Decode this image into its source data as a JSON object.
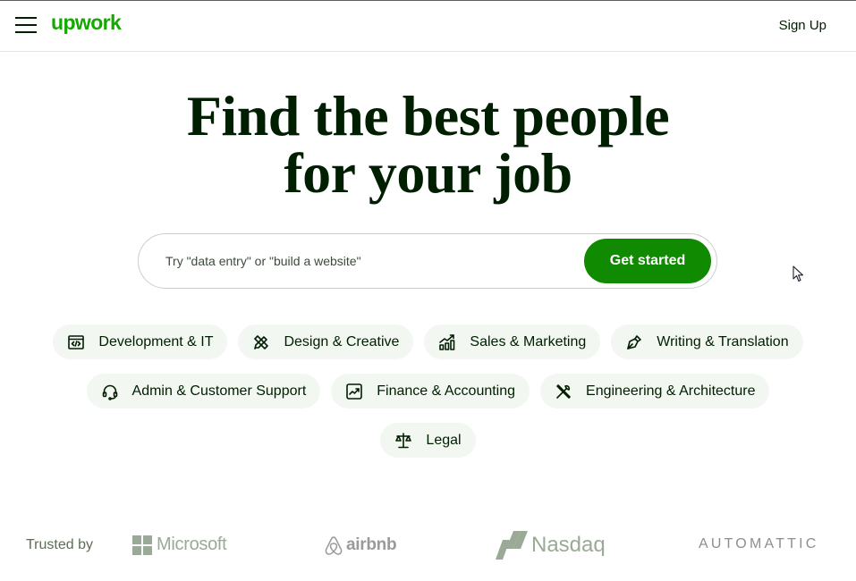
{
  "header": {
    "logo": "upwork",
    "menu_icon": "hamburger-menu-icon",
    "sign_up": "Sign Up"
  },
  "hero": {
    "title_line1": "Find the best people",
    "title_line2": "for your job"
  },
  "search": {
    "placeholder": "Try \"data entry\" or \"build a website\"",
    "value": "",
    "button": "Get started"
  },
  "categories": {
    "row1": [
      {
        "label": "Development & IT",
        "icon": "code-window-icon"
      },
      {
        "label": "Design & Creative",
        "icon": "pencil-ruler-icon"
      },
      {
        "label": "Sales & Marketing",
        "icon": "bar-chart-up-icon"
      },
      {
        "label": "Writing & Translation",
        "icon": "pen-nib-icon"
      }
    ],
    "row2": [
      {
        "label": "Admin & Customer Support",
        "icon": "headset-icon"
      },
      {
        "label": "Finance & Accounting",
        "icon": "trend-chart-icon"
      },
      {
        "label": "Engineering & Architecture",
        "icon": "tools-icon"
      }
    ],
    "row3": [
      {
        "label": "Legal",
        "icon": "scales-icon"
      }
    ]
  },
  "trusted": {
    "label": "Trusted by",
    "brands": [
      "Microsoft",
      "airbnb",
      "Nasdaq",
      "AUTOMATTIC"
    ]
  },
  "colors": {
    "brand_green": "#14a800",
    "button_green": "#108a00",
    "text_dark": "#001e00",
    "chip_bg": "#f2f7f2"
  }
}
